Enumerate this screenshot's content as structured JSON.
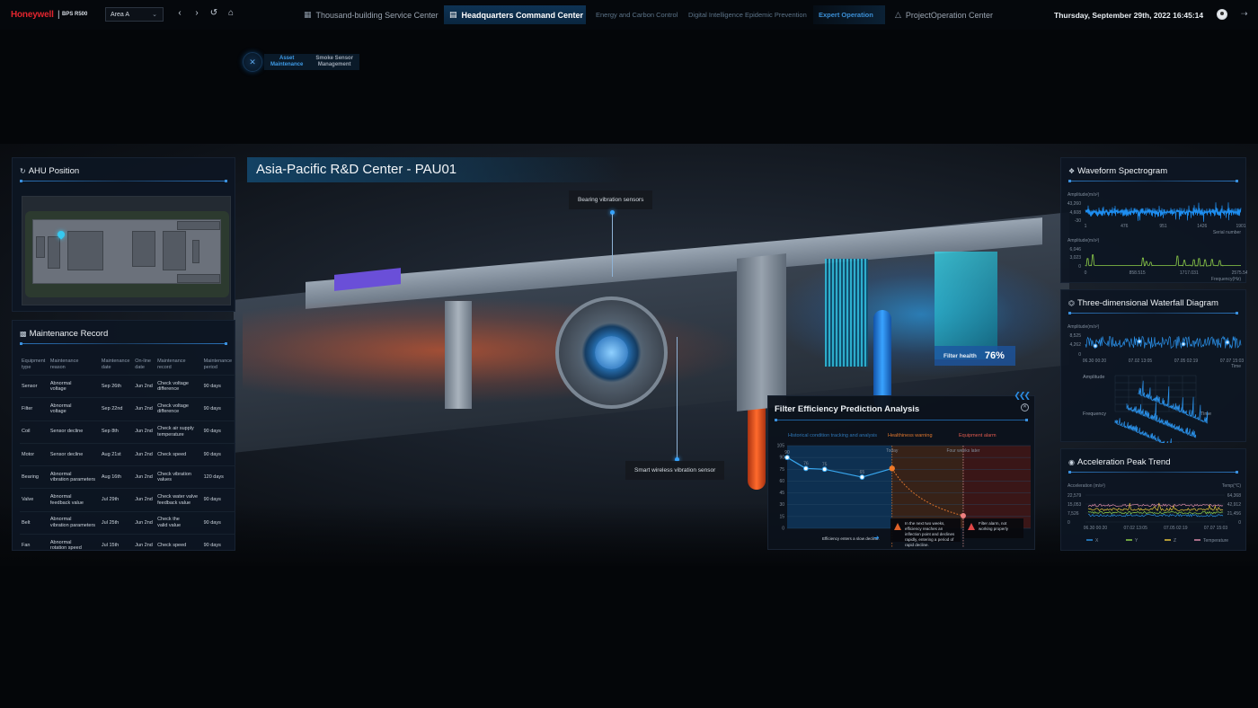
{
  "header": {
    "brand": "Honeywell",
    "brand_separator": "|",
    "product": "BPS R500",
    "area_select": {
      "value": "Area A",
      "icon": "chevron-down-icon"
    },
    "nav_icons": [
      "chevron-left-icon",
      "chevron-right-icon",
      "refresh-icon",
      "home-icon"
    ],
    "tabs": [
      {
        "label": "Thousand-building Service Center",
        "icon": "buildings-icon",
        "state": "normal"
      },
      {
        "label": "Headquarters Command Center",
        "icon": "monitor-icon",
        "state": "active"
      },
      {
        "label": "Energy and Carbon Control",
        "state": "sub"
      },
      {
        "label": "Digital Intelligence Epidemic Prevention",
        "state": "sub"
      },
      {
        "label": "Expert Operation",
        "state": "sub-highlight"
      },
      {
        "label": "ProjectOperation Center",
        "icon": "project-icon",
        "state": "normal"
      }
    ],
    "datetime": "Thursday, September 29th, 2022  16:45:14",
    "user_icon": "avatar",
    "logout_icon": "logout-icon"
  },
  "subnav": {
    "close_icon": "close-icon",
    "items": [
      {
        "label_line1": "Asset",
        "label_line2": "Maintenance",
        "active": true
      },
      {
        "label_line1": "Smoke Sensor",
        "label_line2": "Management",
        "active": false
      }
    ]
  },
  "scene": {
    "title": "Asia-Pacific R&D Center - PAU01",
    "sensors": [
      {
        "label": "Bearing vibration sensors"
      },
      {
        "label": "Smart wireless vibration sensor"
      }
    ],
    "filter_health": {
      "label": "Filter health",
      "value": "76%"
    }
  },
  "ahu_position": {
    "title": "AHU Position",
    "icon": "refresh-icon"
  },
  "maintenance": {
    "title": "Maintenance Record",
    "icon": "record-icon",
    "columns": [
      [
        "Equipment",
        "type"
      ],
      [
        "Maintenance",
        "reason"
      ],
      [
        "Maintenance",
        "date"
      ],
      [
        "On-line",
        "date"
      ],
      [
        "Maintenance",
        "record"
      ],
      [
        "Maintenance",
        "period"
      ]
    ],
    "rows": [
      {
        "type": "Sensor",
        "reason": [
          "Abnormal",
          "voltage"
        ],
        "date": "Sep 26th",
        "online": "Jun 2nd",
        "record": [
          "Check voltage",
          "difference"
        ],
        "period": "90 days"
      },
      {
        "type": "Filter",
        "reason": [
          "Abnormal",
          "voltage"
        ],
        "date": "Sep 22nd",
        "online": "Jun 2nd",
        "record": [
          "Check voltage",
          "difference"
        ],
        "period": "90 days"
      },
      {
        "type": "Coil",
        "reason": [
          "Sensor decline"
        ],
        "date": "Sep 8th",
        "online": "Jun 2nd",
        "record": [
          "Check air supply",
          "temperature"
        ],
        "period": "90 days"
      },
      {
        "type": "Motor",
        "reason": [
          "Sensor decline"
        ],
        "date": "Aug 21st",
        "online": "Jun 2nd",
        "record": [
          "Check speed"
        ],
        "period": "90 days"
      },
      {
        "type": "Bearing",
        "reason": [
          "Abnormal",
          "vibration parameters"
        ],
        "date": "Aug 16th",
        "online": "Jun 2nd",
        "record": [
          "Check vibration",
          "values"
        ],
        "period": "120 days"
      },
      {
        "type": "Valve",
        "reason": [
          "Abnormal",
          "feedback value"
        ],
        "date": "Jul 29th",
        "online": "Jun 2nd",
        "record": [
          "Check water valve",
          "feedback value"
        ],
        "period": "90 days"
      },
      {
        "type": "Belt",
        "reason": [
          "Abnormal",
          "vibration parameters"
        ],
        "date": "Jul 25th",
        "online": "Jun 2nd",
        "record": [
          "Check the",
          "valid value"
        ],
        "period": "90 days"
      },
      {
        "type": "Fan",
        "reason": [
          "Abnormal",
          "rotation speed"
        ],
        "date": "Jul 15th",
        "online": "Jun 2nd",
        "record": [
          "Check speed"
        ],
        "period": "90 days"
      }
    ]
  },
  "waveform": {
    "title": "Waveform Spectrogram",
    "icon": "waveform-icon"
  },
  "waterfall": {
    "title": "Three-dimensional Waterfall Diagram",
    "icon": "hexagon-icon"
  },
  "acceleration": {
    "title": "Acceleration Peak Trend",
    "icon": "target-icon"
  },
  "filter_panel": {
    "title": "Filter Efficiency Prediction Analysis",
    "close_icon": "close-circle-icon",
    "phases": [
      {
        "label": "Historical condition tracking and analysis",
        "color": "#2f78b8"
      },
      {
        "label": "Healthiness warning",
        "color": "#e0772e"
      },
      {
        "label": "Equipment alarm",
        "color": "#e05a4e"
      }
    ],
    "markers": [
      "Today",
      "Four weeks later"
    ],
    "bottom_note": "Efficiency enters a slow decline.",
    "notes": [
      {
        "text": "In the next two weeks, efficiency reaches an inflection point and declines rapidly, entering a period of rapid decline.",
        "icon": "warning-icon"
      },
      {
        "text": "Filter alarm, not working properly",
        "icon": "warning-icon"
      }
    ]
  },
  "chart_data": [
    {
      "id": "waveform_time",
      "type": "line",
      "title": "Waveform Spectrogram (time domain)",
      "ylabel": "Amplitude(m/s²)",
      "xlabel": "Serial number",
      "yticks": [
        "43,260",
        "4,608",
        "-30"
      ],
      "xticks": [
        "1",
        "476",
        "951",
        "1426",
        "1901"
      ],
      "ylim": [
        -30,
        43260
      ],
      "xlim": [
        1,
        1901
      ],
      "color": "#1e8ef0"
    },
    {
      "id": "waveform_freq",
      "type": "line",
      "title": "Waveform Spectrogram (frequency domain)",
      "ylabel": "Amplitude(m/s²)",
      "xlabel": "Frequency(Hz)",
      "yticks": [
        "6,046",
        "3,023",
        "0"
      ],
      "xticks": [
        "0",
        "858.515",
        "1717.031",
        "2575.546"
      ],
      "ylim": [
        0,
        6046
      ],
      "xlim": [
        0,
        2575.546
      ],
      "color": "#8fcf4a",
      "peaks": [
        {
          "x": 30,
          "y": 2600
        },
        {
          "x": 120,
          "y": 3900
        },
        {
          "x": 950,
          "y": 2800
        },
        {
          "x": 1010,
          "y": 1600
        },
        {
          "x": 1080,
          "y": 1300
        },
        {
          "x": 1520,
          "y": 3500
        },
        {
          "x": 1640,
          "y": 2000
        },
        {
          "x": 1790,
          "y": 2200
        },
        {
          "x": 1880,
          "y": 2600
        },
        {
          "x": 1980,
          "y": 2200
        },
        {
          "x": 2100,
          "y": 2300
        },
        {
          "x": 2230,
          "y": 1900
        }
      ]
    },
    {
      "id": "waterfall_trend",
      "type": "line",
      "title": "Three-dimensional Waterfall Diagram",
      "ylabel": "Amplitude(m/s²)",
      "xlabel": "Time",
      "yticks": [
        "8,525",
        "4,262",
        "0"
      ],
      "xticks": [
        "06.30 00:20",
        "07.02 13:05",
        "07.05 02:19",
        "07.07 15:03"
      ],
      "ylim": [
        0,
        8525
      ],
      "color": "#2a90e8",
      "axis3d": {
        "x": "Frequency",
        "y": "Amplitude",
        "z": "Time"
      }
    },
    {
      "id": "acceleration_peak",
      "type": "line",
      "title": "Acceleration Peak Trend",
      "ylabel": "Acceleration (m/s²)",
      "ylabel_right": "Temp(°C)",
      "yticks": [
        "22,579",
        "15,053",
        "7,526",
        "0"
      ],
      "yticks_right": [
        "64,368",
        "42,912",
        "21,456",
        "0"
      ],
      "xticks": [
        "06.30 00:20",
        "07.02 13:05",
        "07.05 02:19",
        "07.07 15:03"
      ],
      "series": [
        {
          "name": "X",
          "color": "#2a8fe0",
          "level": 5500
        },
        {
          "name": "Y",
          "color": "#8fcf4a",
          "level": 7800
        },
        {
          "name": "Z",
          "color": "#e6c53c",
          "level": 10500
        },
        {
          "name": "Temperature",
          "color": "#d98aa8",
          "level": 14000
        }
      ]
    },
    {
      "id": "filter_efficiency",
      "type": "line",
      "title": "Filter Efficiency Prediction Analysis",
      "yticks": [
        "0",
        "15",
        "30",
        "45",
        "60",
        "75",
        "90",
        "105"
      ],
      "ylim": [
        0,
        105
      ],
      "historical": [
        {
          "x": 0,
          "y": 90,
          "label": "90"
        },
        {
          "x": 1,
          "y": 76,
          "label": "76"
        },
        {
          "x": 2,
          "y": 75,
          "label": "75"
        },
        {
          "x": 4,
          "y": 65,
          "label": "65"
        },
        {
          "x": 5.6,
          "y": 76,
          "label": ""
        }
      ],
      "prediction": [
        {
          "x": 5.6,
          "y": 76
        },
        {
          "x": 6.4,
          "y": 45
        },
        {
          "x": 7.6,
          "y": 27
        },
        {
          "x": 9.4,
          "y": 16
        }
      ],
      "today_x": 5.6,
      "four_weeks_x": 9.4,
      "x_max": 13
    }
  ]
}
